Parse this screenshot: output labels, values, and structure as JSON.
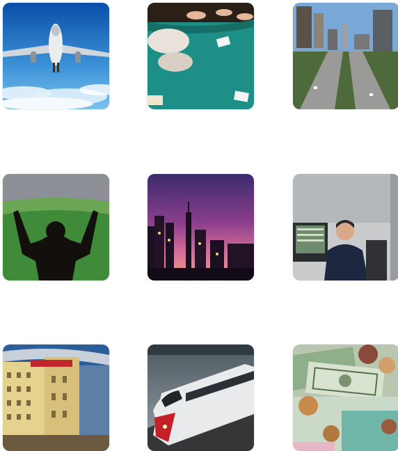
{
  "grid": {
    "tiles": [
      {
        "icon": "airplane-icon"
      },
      {
        "icon": "casino-table-icon"
      },
      {
        "icon": "city-highway-icon"
      },
      {
        "icon": "stadium-fan-icon"
      },
      {
        "icon": "city-skyline-sunset-icon"
      },
      {
        "icon": "security-officer-icon"
      },
      {
        "icon": "hotel-building-icon"
      },
      {
        "icon": "high-speed-train-icon"
      },
      {
        "icon": "currency-money-icon"
      }
    ]
  }
}
